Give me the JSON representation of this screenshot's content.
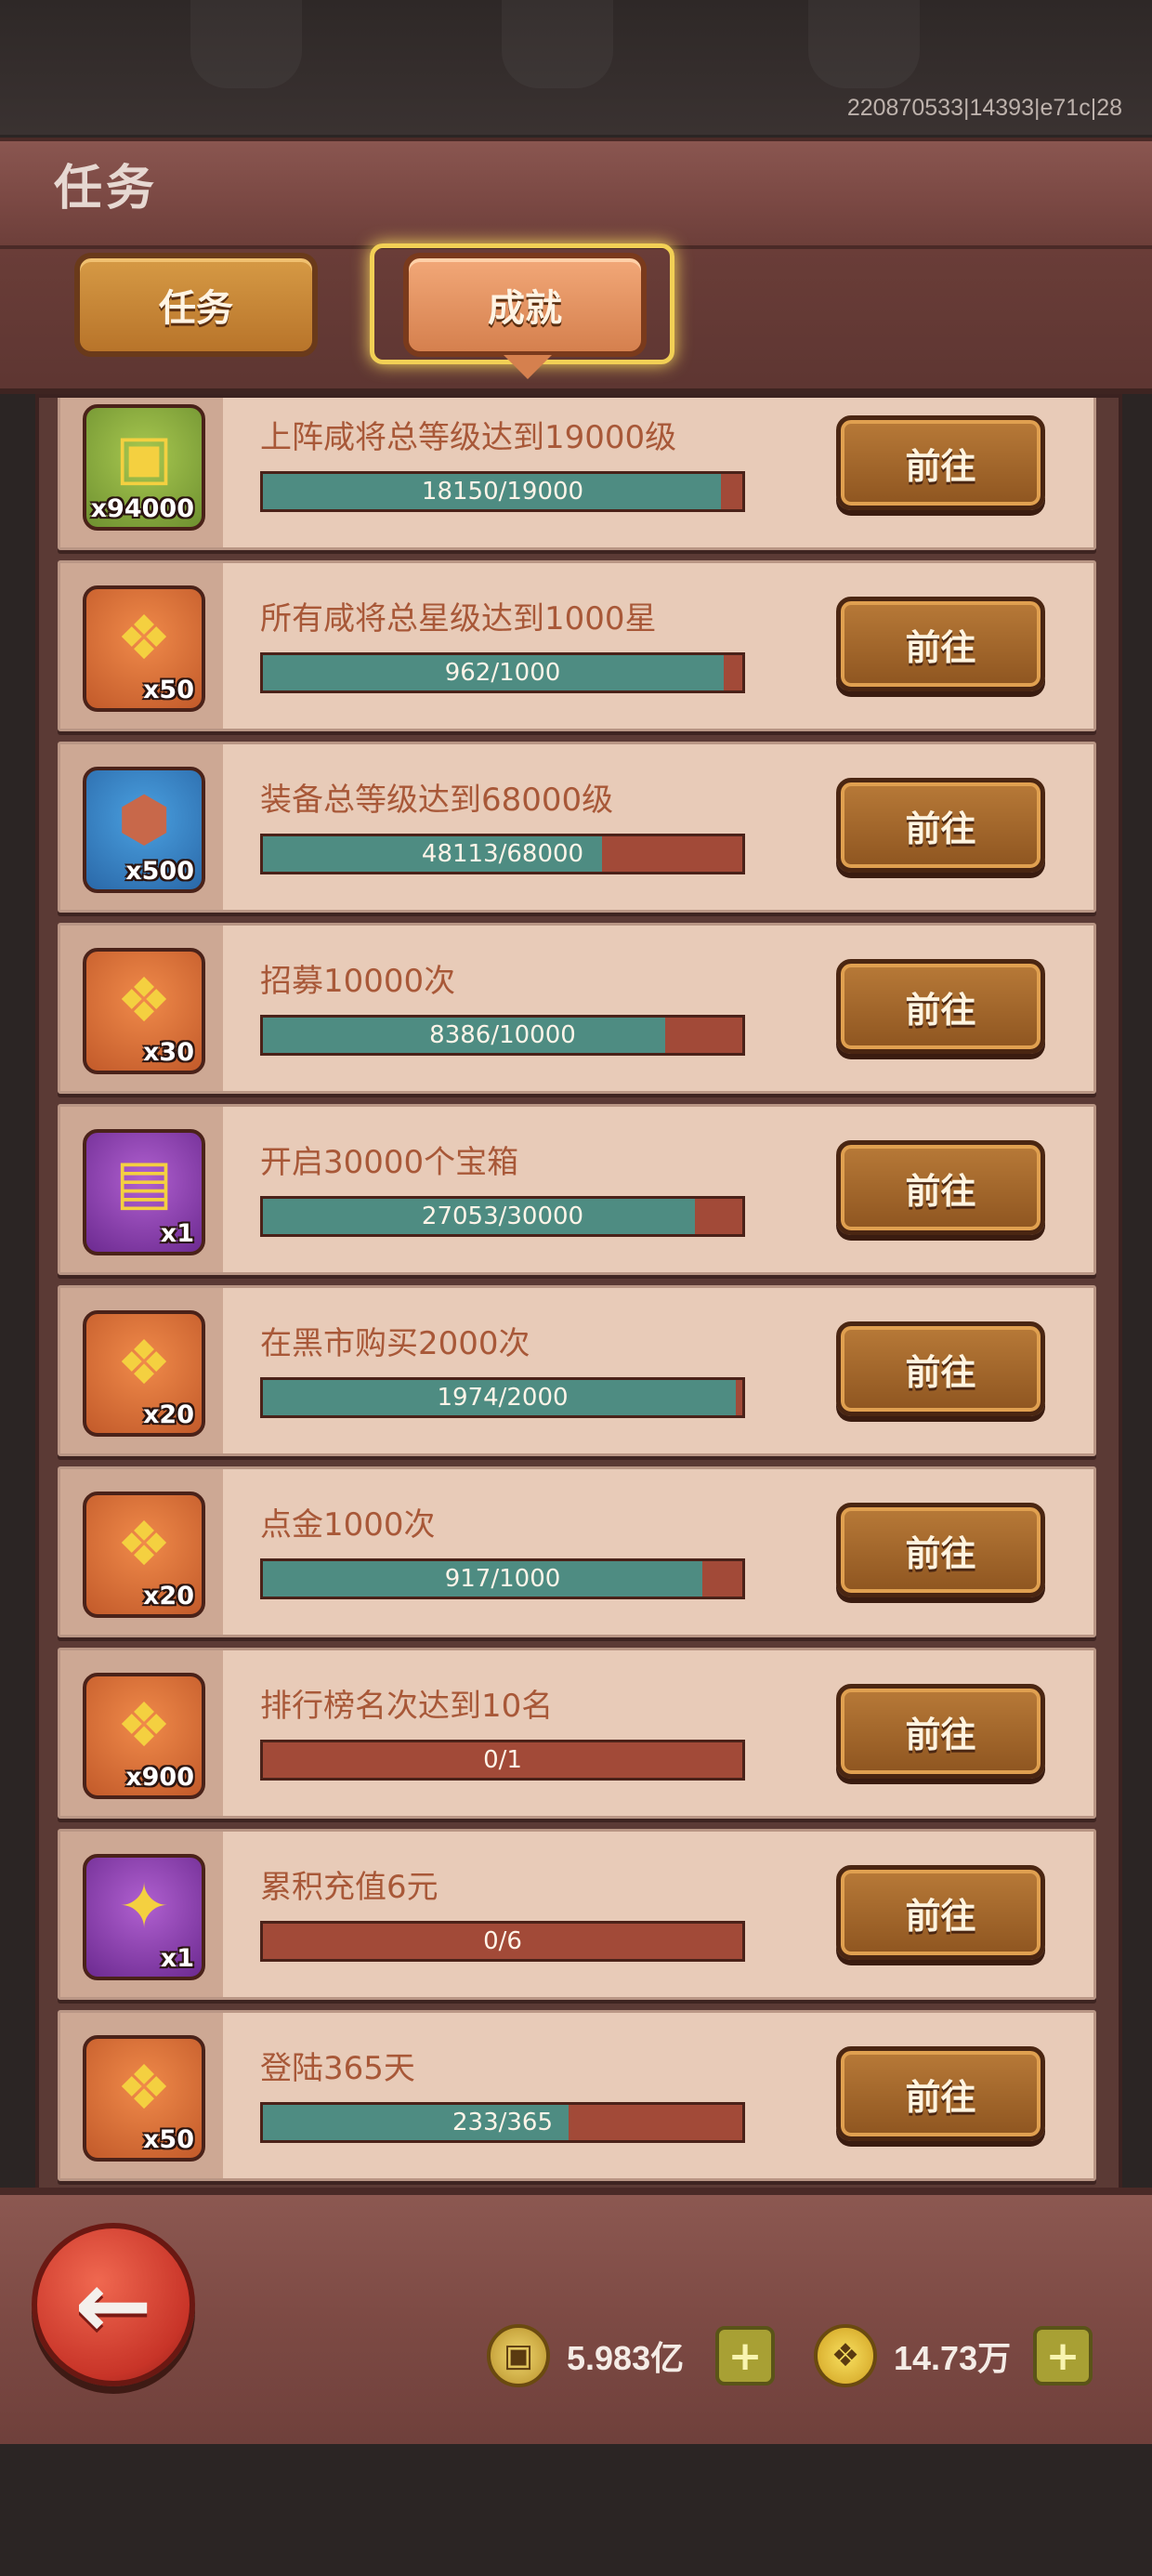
{
  "build_id": "220870533|14393|e71c|28",
  "page_title": "任务",
  "tabs": {
    "task": "任务",
    "achievement": "成就"
  },
  "go_label": "前往",
  "achievements": [
    {
      "text": "上阵咸将总等级达到19000级",
      "progress": "18150/19000",
      "fraction": 0.955,
      "reward_qty": "x94000",
      "reward_icon": "copper-coin-icon",
      "reward_color": "green"
    },
    {
      "text": "所有咸将总星级达到1000星",
      "progress": "962/1000",
      "fraction": 0.962,
      "reward_qty": "x50",
      "reward_icon": "gold-scroll-icon",
      "reward_color": "orange"
    },
    {
      "text": "装备总等级达到68000级",
      "progress": "48113/68000",
      "fraction": 0.708,
      "reward_qty": "x500",
      "reward_icon": "ore-stone-icon",
      "reward_color": "blue"
    },
    {
      "text": "招募10000次",
      "progress": "8386/10000",
      "fraction": 0.839,
      "reward_qty": "x30",
      "reward_icon": "gold-scroll-icon",
      "reward_color": "orange"
    },
    {
      "text": "开启30000个宝箱",
      "progress": "27053/30000",
      "fraction": 0.902,
      "reward_qty": "x1",
      "reward_icon": "treasure-chest-icon",
      "reward_color": "purple"
    },
    {
      "text": "在黑市购买2000次",
      "progress": "1974/2000",
      "fraction": 0.987,
      "reward_qty": "x20",
      "reward_icon": "gold-scroll-icon",
      "reward_color": "orange"
    },
    {
      "text": "点金1000次",
      "progress": "917/1000",
      "fraction": 0.917,
      "reward_qty": "x20",
      "reward_icon": "gold-scroll-icon",
      "reward_color": "orange"
    },
    {
      "text": "排行榜名次达到10名",
      "progress": "0/1",
      "fraction": 0,
      "reward_qty": "x900",
      "reward_icon": "gold-scroll-icon",
      "reward_color": "orange"
    },
    {
      "text": "累积充值6元",
      "progress": "0/6",
      "fraction": 0,
      "reward_qty": "x1",
      "reward_icon": "golden-torch-icon",
      "reward_color": "purple"
    },
    {
      "text": "登陆365天",
      "progress": "233/365",
      "fraction": 0.638,
      "reward_qty": "x50",
      "reward_icon": "gold-scroll-icon",
      "reward_color": "orange"
    }
  ],
  "currencies": [
    {
      "icon": "copper-coin-icon",
      "value": "5.983亿"
    },
    {
      "icon": "gold-scroll-icon",
      "value": "14.73万"
    }
  ],
  "colors": {
    "bar_fill": "#4e8c82",
    "bar_empty": "#a24a38",
    "card_bg": "#e8cbb8",
    "text_accent": "#a85838"
  }
}
